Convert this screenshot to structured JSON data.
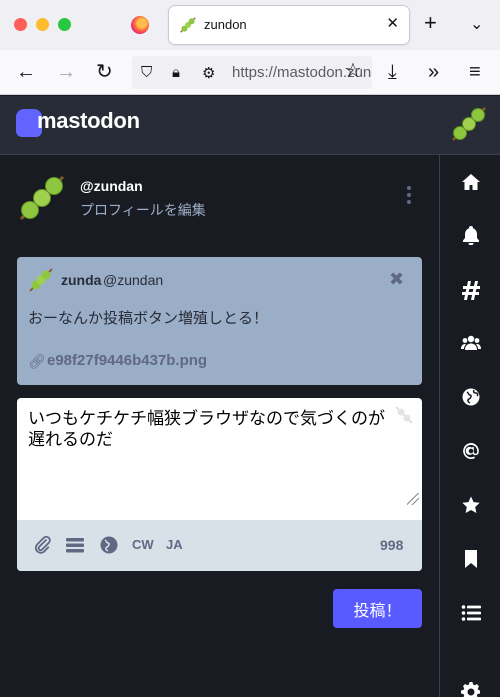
{
  "browser": {
    "tab_title": "zundon",
    "tab_close": "✕",
    "new_tab": "+",
    "tab_list": "⌄",
    "url": "https://mastodon.zunda.ninja/web/statuses/new"
  },
  "app": {
    "brand": "mastodon",
    "icon_colors": {
      "brand": "#6364ff",
      "accent_button": "#595aff",
      "reply_bg": "#9baec8"
    }
  },
  "profile": {
    "handle": "@zundan",
    "edit_link": "プロフィールを編集"
  },
  "reply": {
    "display_name": "zunda",
    "acct": "@zundan",
    "text": "おーなんか投稿ボタン増殖しとる！",
    "attachment": "e98f27f9446b437b.png",
    "close": "✖"
  },
  "composer": {
    "text": "いつもケチケチ幅狭ブラウザなので気づくのが遅れるのだ",
    "cw_label": "CW",
    "lang_label": "JA",
    "char_count": "998",
    "post_label": "投稿！"
  },
  "nav_icons": [
    "home-icon",
    "bell-icon",
    "hashtag-icon",
    "people-icon",
    "globe-icon",
    "at-icon",
    "star-icon",
    "bookmark-icon",
    "list-icon",
    "gear-icon"
  ]
}
